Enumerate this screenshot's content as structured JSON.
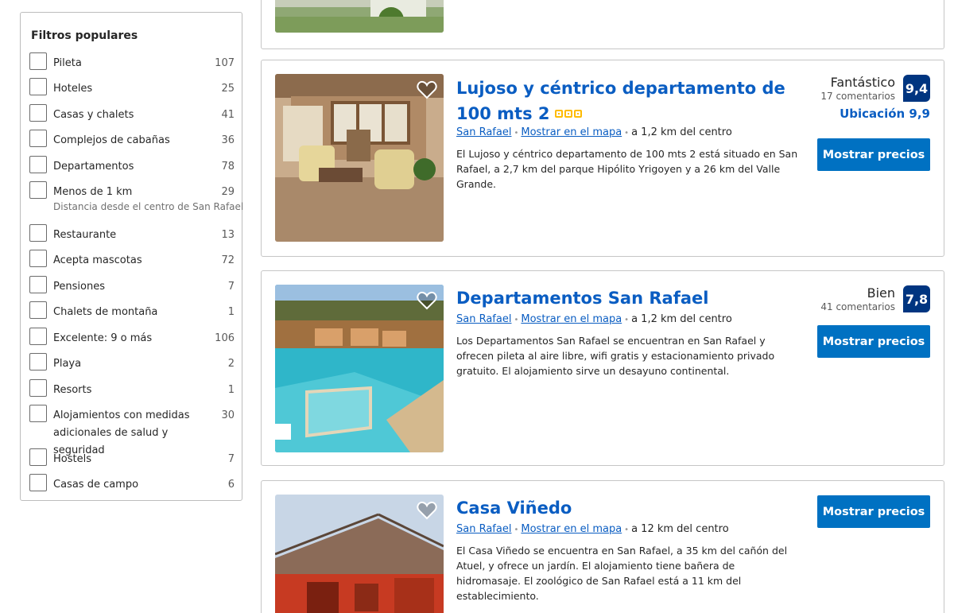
{
  "filters": {
    "title": "Filtros populares",
    "items": [
      {
        "label": "Pileta",
        "count": "107"
      },
      {
        "label": "Hoteles",
        "count": "25"
      },
      {
        "label": "Casas y chalets",
        "count": "41"
      },
      {
        "label": "Complejos de cabañas",
        "count": "36"
      },
      {
        "label": "Departamentos",
        "count": "78"
      },
      {
        "label": "Menos de 1 km",
        "count": "29",
        "sub": "Distancia desde el centro de San Rafael"
      },
      {
        "label": "Restaurante",
        "count": "13"
      },
      {
        "label": "Acepta mascotas",
        "count": "72"
      },
      {
        "label": "Pensiones",
        "count": "7"
      },
      {
        "label": "Chalets de montaña",
        "count": "1"
      },
      {
        "label": "Excelente: 9 o más",
        "count": "106"
      },
      {
        "label": "Playa",
        "count": "2"
      },
      {
        "label": "Resorts",
        "count": "1"
      },
      {
        "label": "Alojamientos con medidas adicionales de salud y seguridad",
        "count": "30"
      },
      {
        "label": "Hostels",
        "count": "7"
      },
      {
        "label": "Casas de campo",
        "count": "6"
      }
    ]
  },
  "properties": [
    {
      "title": "Lujoso y céntrico departamento de 100 mts 2",
      "city_link": "San Rafael",
      "map_link": "Mostrar en el mapa",
      "distance": "a 1,2 km del centro",
      "description": "El Lujoso y céntrico departamento de 100 mts 2 está situado en San Rafael, a 2,7 km del parque Hipólito Yrigoyen y a 26 km del Valle Grande.",
      "rating_word": "Fantástico",
      "reviews": "17 comentarios",
      "score": "9,4",
      "location_score": "Ubicación 9,9",
      "button": "Mostrar precios",
      "stars": 3
    },
    {
      "title": "Departamentos San Rafael",
      "city_link": "San Rafael",
      "map_link": "Mostrar en el mapa",
      "distance": "a 1,2 km del centro",
      "description": "Los Departamentos San Rafael se encuentran en San Rafael y ofrecen pileta al aire libre, wifi gratis y estacionamiento privado gratuito. El alojamiento sirve un desayuno continental.",
      "rating_word": "Bien",
      "reviews": "41 comentarios",
      "score": "7,8",
      "button": "Mostrar precios"
    },
    {
      "title": "Casa Viñedo",
      "city_link": "San Rafael",
      "map_link": "Mostrar en el mapa",
      "distance": "a 12 km del centro",
      "description": "El Casa Viñedo se encuentra en San Rafael, a 35 km del cañón del Atuel, y ofrece un jardín. El alojamiento tiene bañera de hidromasaje. El zoológico de San Rafael está a 11 km del establecimiento.",
      "button": "Mostrar precios"
    }
  ],
  "colors": {
    "link": "#0a5dc2",
    "button": "#0071c2",
    "score_badge": "#003580",
    "star": "#febb02"
  }
}
